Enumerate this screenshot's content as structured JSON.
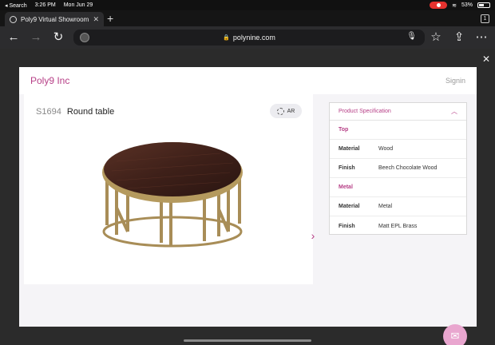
{
  "status_bar": {
    "back_label": "◂ Search",
    "time": "3:26 PM",
    "date": "Mon Jun 29",
    "battery": "53%"
  },
  "tabs": [
    {
      "label": "Poly9 Virtual Showroom"
    }
  ],
  "tab_count": "1",
  "url": "polynine.com",
  "modal": {
    "brand": "Poly9 Inc",
    "signin": "Signin"
  },
  "product": {
    "code": "S1694",
    "name": "Round table",
    "ar_label": "AR"
  },
  "spec": {
    "title": "Product Specification",
    "groups": [
      {
        "name": "Top",
        "rows": [
          {
            "key": "Material",
            "value": "Wood"
          },
          {
            "key": "Finish",
            "value": "Beech Chocolate Wood"
          }
        ]
      },
      {
        "name": "Metal",
        "rows": [
          {
            "key": "Material",
            "value": "Metal"
          },
          {
            "key": "Finish",
            "value": "Matt EPL Brass"
          }
        ]
      }
    ]
  },
  "colors": {
    "accent": "#b63e86",
    "fab": "#e9a6cf"
  }
}
